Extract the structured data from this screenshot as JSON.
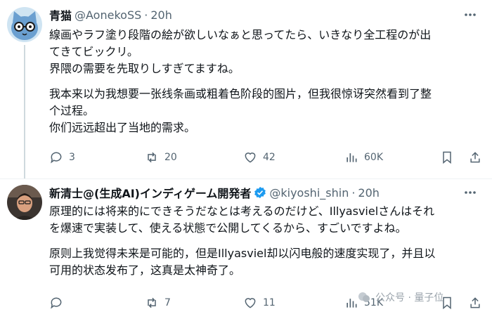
{
  "posts": [
    {
      "name": "青猫",
      "handle": "@AonekoSS",
      "time": "20h",
      "dot": "·",
      "paragraphs": [
        "線画やラフ塗り段階の絵が欲しいなぁと思ってたら、いきなり全工程のが出",
        "てきてビックリ。",
        "界隈の需要を先取りしすぎてますね。",
        "我本来以为我想要一张线条画或粗着色阶段的图片，但我很惊讶突然看到了整",
        "个过程。",
        "你们远远超出了当地的需求。"
      ],
      "replies": "3",
      "reposts": "20",
      "likes": "42",
      "views": "60K"
    },
    {
      "name": "新清士@(生成AI)インディゲーム開発者",
      "handle": "@kiyoshi_shin",
      "time": "20h",
      "dot": "·",
      "paragraphs": [
        "原理的には将来的にできそうだなとは考えるのだけど、Illyasvielさんはそれ",
        "を爆速で実装して、使える状態で公開してくるから、すごいですよね。",
        "原则上我觉得未来是可能的，但是Illyasviel却以闪电般的速度实现了，并且以",
        "可用的状态发布了，这真是太神奇了。"
      ],
      "replies": "",
      "reposts": "7",
      "likes": "11",
      "views": "51K"
    }
  ],
  "watermark": "公众号 · 量子位",
  "colors": {
    "text": "#0f1419",
    "muted": "#536471",
    "verified": "#1d9bf0",
    "divider": "#eff3f4"
  }
}
